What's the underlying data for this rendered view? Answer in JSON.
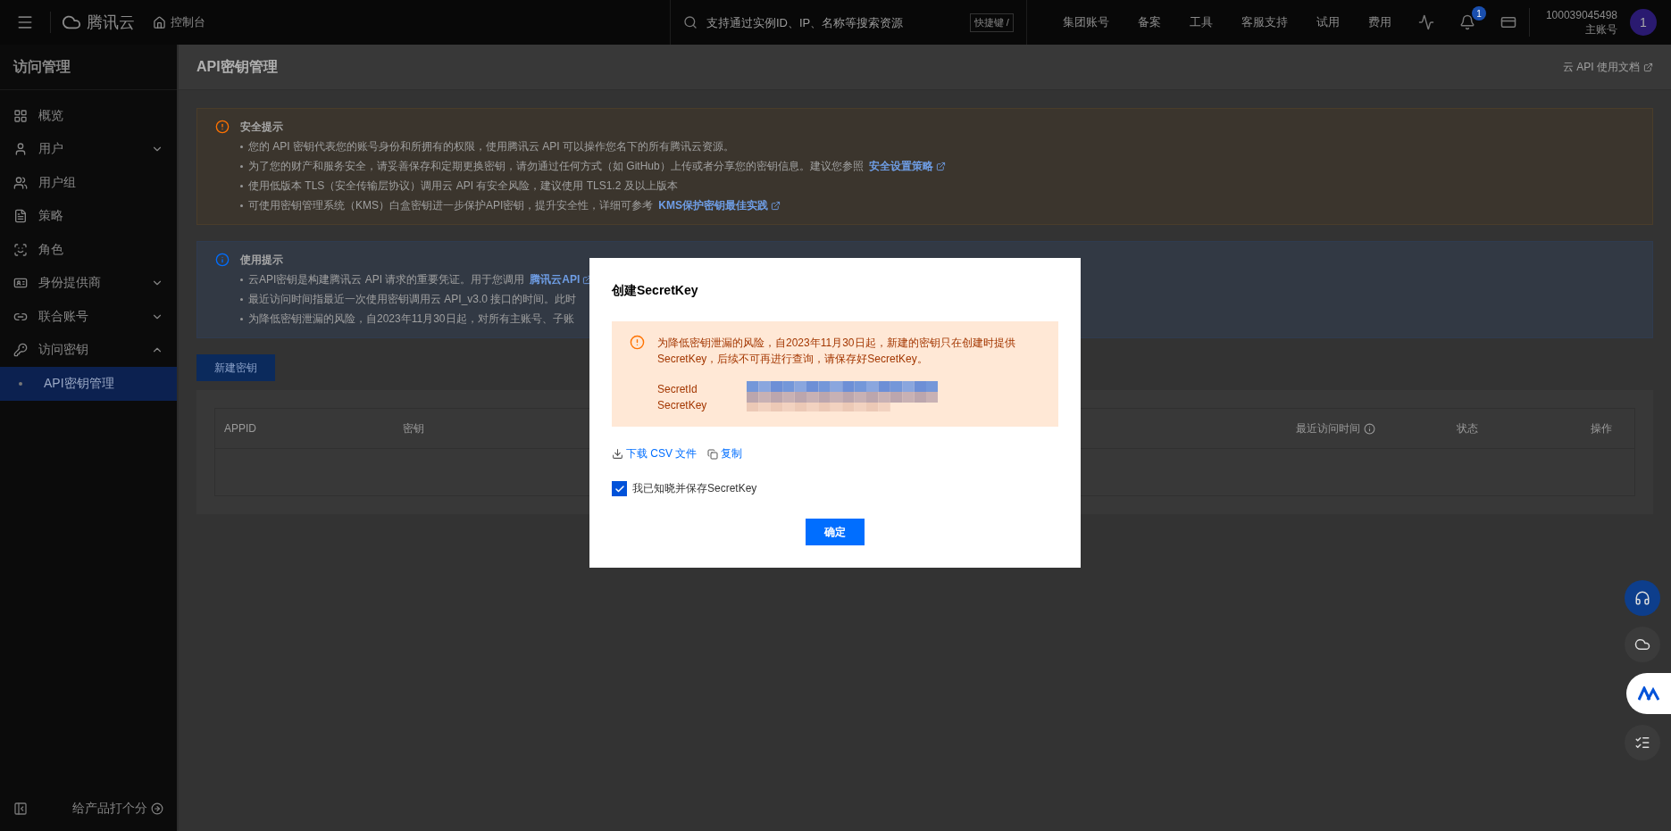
{
  "topbar": {
    "brand": "腾讯云",
    "console": "控制台",
    "search": {
      "placeholder": "支持通过实例ID、IP、名称等搜索资源"
    },
    "shortcut": "快捷键 /",
    "nav": [
      "集团账号",
      "备案",
      "工具",
      "客服支持",
      "试用",
      "费用"
    ],
    "notification_count": "1",
    "account": {
      "id": "100039045498",
      "role": "主账号",
      "avatar": "1"
    }
  },
  "sidebar": {
    "title": "访问管理",
    "items": [
      {
        "label": "概览",
        "has_children": false,
        "selected": false
      },
      {
        "label": "用户",
        "expanded": false,
        "has_children": true,
        "selected": false
      },
      {
        "label": "用户组",
        "has_children": false,
        "selected": false
      },
      {
        "label": "策略",
        "has_children": false,
        "selected": false
      },
      {
        "label": "角色",
        "has_children": false,
        "selected": false
      },
      {
        "label": "身份提供商",
        "expanded": false,
        "has_children": true,
        "selected": false
      },
      {
        "label": "联合账号",
        "expanded": false,
        "has_children": true,
        "selected": false
      },
      {
        "label": "访问密钥",
        "expanded": true,
        "has_children": true,
        "selected": false,
        "children": [
          {
            "label": "API密钥管理",
            "selected": true
          }
        ]
      }
    ],
    "feedback": "给产品打个分"
  },
  "page": {
    "title": "API密钥管理",
    "doc_link": "云 API 使用文档"
  },
  "notices": [
    {
      "kind": "warning",
      "title": "安全提示",
      "items": [
        {
          "text": "您的 API 密钥代表您的账号身份和所拥有的权限，使用腾讯云 API 可以操作您名下的所有腾讯云资源。"
        },
        {
          "text": "为了您的财产和服务安全，请妥善保存和定期更换密钥，请勿通过任何方式（如 GitHub）上传或者分享您的密钥信息。建议您参照",
          "link": "安全设置策略"
        },
        {
          "text": "使用低版本 TLS（安全传输层协议）调用云 API 有安全风险，建议使用 TLS1.2 及以上版本"
        },
        {
          "text": "可使用密钥管理系统（KMS）白盒密钥进一步保护API密钥，提升安全性，详细可参考",
          "link": "KMS保护密钥最佳实践"
        }
      ]
    },
    {
      "kind": "info",
      "title": "使用提示",
      "items": [
        {
          "text": "云API密钥是构建腾讯云 API 请求的重要凭证。用于您调用",
          "link": "腾讯云API"
        },
        {
          "text": "最近访问时间指最近一次使用密钥调用云 API_v3.0 接口的时间。此时"
        },
        {
          "text": "为降低密钥泄漏的风险，自2023年11月30日起，对所有主账号、子账"
        }
      ]
    }
  ],
  "new_key_button": "新建密钥",
  "table": {
    "columns": [
      "APPID",
      "密钥",
      "最近访问时间",
      "状态",
      "操作"
    ]
  },
  "dialog": {
    "title": "创建SecretKey",
    "warning": "为降低密钥泄漏的风险，自2023年11月30日起，新建的密钥只在创建时提供SecretKey，后续不可再进行查询，请保存好SecretKey。",
    "fields": [
      "SecretId",
      "SecretKey"
    ],
    "download": "下载 CSV 文件",
    "copy": "复制",
    "acknowledge": {
      "label": "我已知晓并保存SecretKey",
      "checked": true
    },
    "confirm": "确定"
  }
}
